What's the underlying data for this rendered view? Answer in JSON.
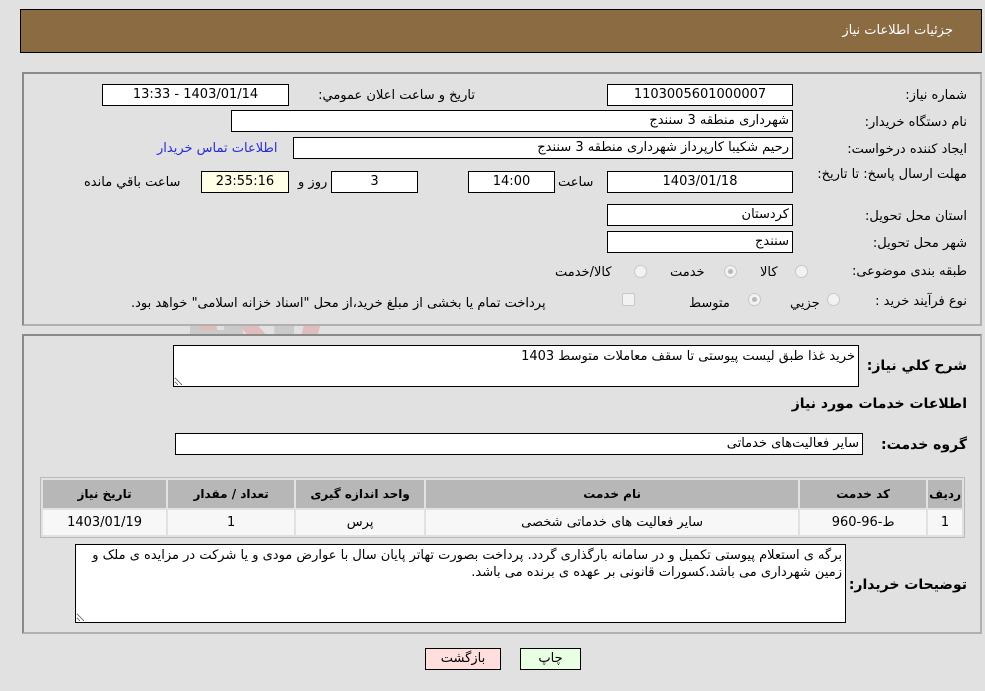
{
  "header": {
    "title": "جزئیات اطلاعات نیاز"
  },
  "details": {
    "need_number_label": "شماره نیاز:",
    "need_number": "1103005601000007",
    "announce_label": "تاریخ و ساعت اعلان عمومي:",
    "announce_value": "1403/01/14 - 13:33",
    "buyer_org_label": "نام دستگاه خريدار:",
    "buyer_org": "شهرداری منطقه 3 سنندج",
    "creator_label": "ایجاد کننده درخواست:",
    "creator": "رحیم شکیبا کارپرداز شهرداری منطقه 3 سنندج",
    "buyer_contact_link": "اطلاعات تماس خريدار",
    "deadline_label": "مهلت ارسال پاسخ: تا تاریخ:",
    "deadline_date": "1403/01/18",
    "time_label": "ساعت",
    "deadline_time": "14:00",
    "days_value": "3",
    "days_label": "روز و",
    "remaining_time": "23:55:16",
    "remaining_label": "ساعت باقي مانده",
    "province_label": "استان محل تحویل:",
    "province": "کردستان",
    "city_label": "شهر محل تحویل:",
    "city": "سنندج",
    "category_label": "طبقه بندی موضوعی:",
    "category_options": [
      {
        "label": "کالا",
        "selected": false
      },
      {
        "label": "خدمت",
        "selected": true
      },
      {
        "label": "کالا/خدمت",
        "selected": false
      }
    ],
    "process_label": "نوع فرآیند خرید :",
    "process_options": [
      {
        "label": "جزیي",
        "selected": false
      },
      {
        "label": "متوسط",
        "selected": true
      }
    ],
    "treasury_note": "پرداخت تمام یا بخشی از مبلغ خرید،از محل \"اسناد خزانه اسلامی\" خواهد بود.",
    "treasury_checked": false
  },
  "needs": {
    "summary_label": "شرح کلي نياز:",
    "summary": "خرید غذا طبق لیست پیوستی تا سقف معاملات متوسط 1403",
    "services_heading": "اطلاعات خدمات مورد نياز",
    "service_group_label": "گروه خدمت:",
    "service_group": "سایر فعالیت‌های خدماتی",
    "table": {
      "columns": [
        "رديف",
        "کد خدمت",
        "نام خدمت",
        "واحد اندازه گيری",
        "تعداد / مقدار",
        "تاريخ نياز"
      ],
      "rows": [
        [
          "1",
          "ط-96-960",
          "سایر فعالیت های خدماتی شخصی",
          "پرس",
          "1",
          "1403/01/19"
        ]
      ]
    },
    "buyer_notes_label": "توضيحات خريدار:",
    "buyer_notes": "برگه ی استعلام پیوستی تکمیل و در سامانه بارگذاری گردد. پرداخت بصورت تهاتر پایان سال با عوارض مودی و یا شرکت در مزایده ی ملک و زمین شهرداری می باشد.کسورات قانونی بر عهده ی برنده می باشد."
  },
  "buttons": {
    "print": "چاپ",
    "back": "بازگشت"
  },
  "watermark": {
    "text": "AriaTender.neT"
  }
}
